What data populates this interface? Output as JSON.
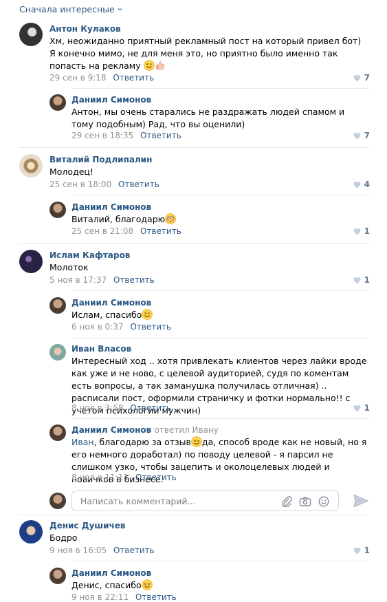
{
  "sort_label": "Сначала интересные",
  "reply_label": "Ответить",
  "composer_placeholder": "Написать комментарий...",
  "colors": {
    "link": "#2a5885",
    "muted": "#939393",
    "separator": "#e7e8ec"
  },
  "comments": [
    {
      "author": "Антон Кулаков",
      "text": "Хм, неожиданно приятный рекламный пост на который привел бот) Я конечно мимо, не для меня это, но приятно было именно так попасть на рекламу",
      "emoji": [
        "smile-emoji",
        "thumbs-up-emoji"
      ],
      "time": "29 сен в 9:18",
      "likes": "7"
    },
    {
      "author": "Даниил Симонов",
      "text": "Антон, мы очень старались не раздражать людей спамом и тому подобным) Рад, что вы оценили)",
      "time": "29 сен в 18:35",
      "likes": "7"
    },
    {
      "author": "Виталий Подлипалин",
      "text": "Молодец!",
      "time": "25 сен в 18:00",
      "likes": "4"
    },
    {
      "author": "Даниил Симонов",
      "text": "Виталий, благодарю",
      "emoji": [
        "flushed-emoji"
      ],
      "time": "25 сен в 21:08",
      "likes": "1"
    },
    {
      "author": "Ислам Кафтаров",
      "text": "Молоток",
      "time": "5 ноя в 17:37",
      "likes": "1"
    },
    {
      "author": "Даниил Симонов",
      "text": "Ислам, спасибо",
      "emoji": [
        "smile-emoji"
      ],
      "time": "6 ноя в 0:37"
    },
    {
      "author": "Иван Власов",
      "text": "Интересный ход .. хотя привлекать клиентов через лайки вроде как уже и не ново, с целевой аудиторией, судя по коментам есть вопросы, а так заманушка получилась отличная) .. расписали пост, оформили страничку и фотки нормально!! с учетом психологии мужчин)",
      "time": "8 ноя в 3:58",
      "likes": "1"
    },
    {
      "author": "Даниил Симонов",
      "replied_to": "ответил Ивану",
      "mention": "Иван",
      "text_a": ", благодарю за отзыв",
      "text_b": "да, способ вроде как не новый, но я его немного доработал) по поводу целевой - я парсил не слишком узко, чтобы зацепить и околоцелевых людей и новичков в бизнесе.",
      "emoji": [
        "relieved-emoji"
      ],
      "time": "8 ноя в 11:11"
    },
    {
      "author": "Денис Душичев",
      "text": "Бодро",
      "time": "9 ноя в 16:05",
      "likes": "1"
    },
    {
      "author": "Даниил Симонов",
      "text": "Денис, спасибо",
      "emoji": [
        "relieved-emoji"
      ],
      "time": "9 ноя в 22:11"
    }
  ]
}
